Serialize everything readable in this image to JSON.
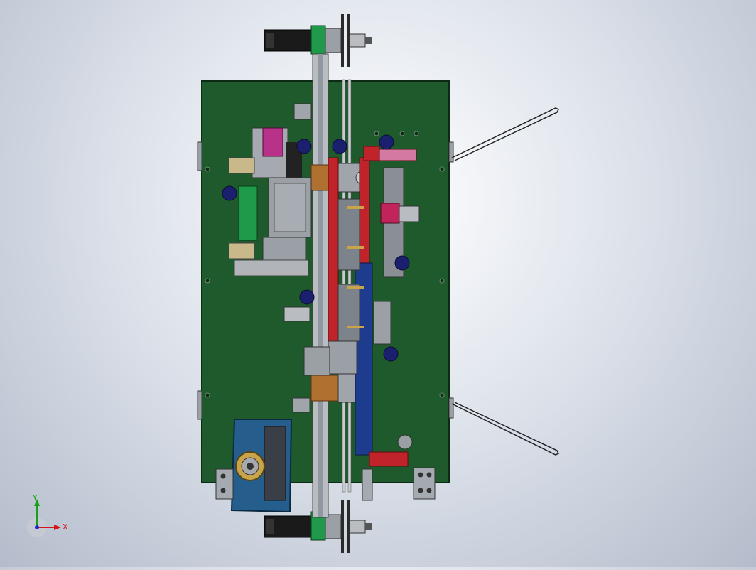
{
  "view": {
    "background_top": "#ffffff",
    "background_bottom": "#b4bccb"
  },
  "colors": {
    "base_plate": "#1e5a2c",
    "base_plate_edge": "#0d2a14",
    "rail": "#b9bdc2",
    "motor": "#1a1a1a",
    "bracket_green": "#1f9a4a",
    "bronze": "#b07030",
    "red_part": "#c0242a",
    "blue_part": "#1e3c8e",
    "dark_blue_knob": "#1a1f6e",
    "steel_gray": "#8a8f96",
    "cable": "#222222"
  },
  "triad": {
    "x_label": "X",
    "y_label": "Y",
    "x_color": "#d01818",
    "y_color": "#18a018",
    "z_color": "#1828c8"
  }
}
